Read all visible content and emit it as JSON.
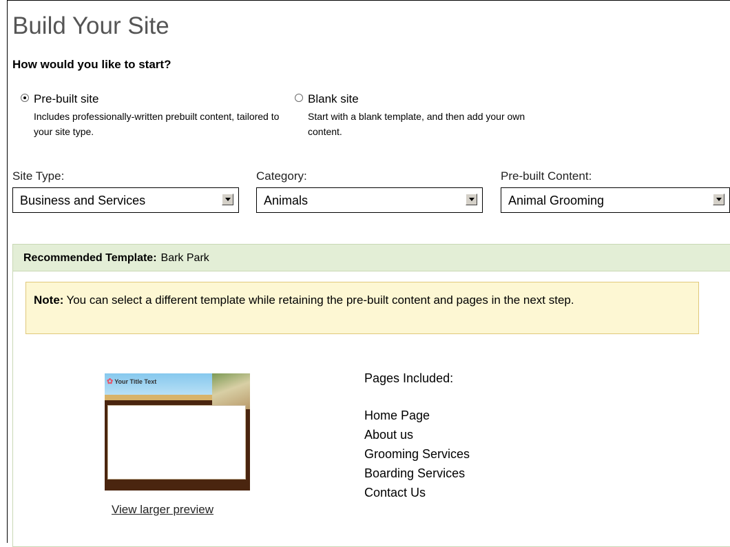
{
  "page": {
    "title": "Build Your Site",
    "question": "How would you like to start?"
  },
  "start_options": [
    {
      "label": "Pre-built site",
      "description": "Includes professionally-written prebuilt content, tailored to your site type.",
      "selected": true
    },
    {
      "label": "Blank site",
      "description": "Start with a blank template, and then add your own content.",
      "selected": false
    }
  ],
  "selectors": {
    "site_type": {
      "label": "Site Type:",
      "value": "Business and Services"
    },
    "category": {
      "label": "Category:",
      "value": "Animals"
    },
    "prebuilt_content": {
      "label": "Pre-built Content:",
      "value": "Animal Grooming"
    }
  },
  "recommended": {
    "label": "Recommended Template:",
    "template_name": "Bark Park"
  },
  "note": {
    "label": "Note:",
    "text": "You can select a different template while retaining the pre-built content and pages in the next step."
  },
  "preview": {
    "thumb_title": "Your Title Text",
    "link_text": "View larger preview"
  },
  "pages_included": {
    "title": "Pages Included:",
    "items": [
      "Home Page",
      "About us",
      "Grooming Services",
      "Boarding Services",
      "Contact Us"
    ]
  },
  "colors": {
    "header_bg": "#e3eed6",
    "note_bg": "#fdf7d3",
    "title_gray": "#555555"
  }
}
